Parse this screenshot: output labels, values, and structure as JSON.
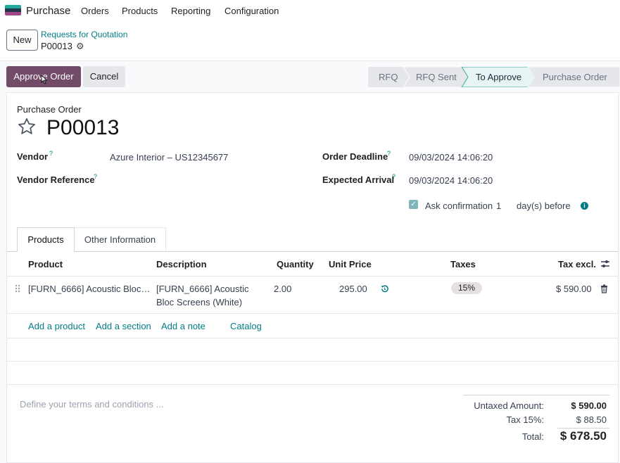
{
  "nav": {
    "app_name": "Purchase",
    "menu": [
      "Orders",
      "Products",
      "Reporting",
      "Configuration"
    ]
  },
  "control": {
    "new_label": "New",
    "breadcrumb": "Requests for Quotation",
    "record": "P00013"
  },
  "actions": {
    "approve_label": "Approve Order",
    "cancel_label": "Cancel"
  },
  "statusbar": {
    "stages": [
      "RFQ",
      "RFQ Sent",
      "To Approve",
      "Purchase Order"
    ],
    "active": "To Approve"
  },
  "form": {
    "subtitle": "Purchase Order",
    "title": "P00013",
    "vendor_label": "Vendor",
    "vendor_value": "Azure Interior – US12345677",
    "vendor_ref_label": "Vendor Reference",
    "order_deadline_label": "Order Deadline",
    "order_deadline_value": "09/03/2024 14:06:20",
    "expected_arrival_label": "Expected Arrival",
    "expected_arrival_value": "09/03/2024 14:06:20",
    "ask_confirmation_label": "Ask confirmation",
    "ask_confirmation_days": "1",
    "days_before_label": "day(s) before",
    "help_mark": "?"
  },
  "tabs": [
    "Products",
    "Other Information"
  ],
  "table": {
    "headers": {
      "product": "Product",
      "description": "Description",
      "quantity": "Quantity",
      "unit_price": "Unit Price",
      "taxes": "Taxes",
      "tax_excl": "Tax excl."
    },
    "rows": [
      {
        "product": "[FURN_6666] Acoustic Bloc…",
        "description_line1": "[FURN_6666] Acoustic",
        "description_line2": "Bloc Screens (White)",
        "quantity": "2.00",
        "unit_price": "295.00",
        "tax": "15%",
        "subtotal": "$ 590.00"
      }
    ],
    "add_links": [
      "Add a product",
      "Add a section",
      "Add a note",
      "Catalog"
    ]
  },
  "terms_placeholder": "Define your terms and conditions ...",
  "totals": {
    "untaxed_label": "Untaxed Amount:",
    "untaxed_value": "$ 590.00",
    "tax_label": "Tax 15%:",
    "tax_value": "$ 88.50",
    "total_label": "Total:",
    "total_value": "$ 678.50"
  },
  "colors": {
    "brand": "#714b67",
    "accent": "#017e84"
  }
}
